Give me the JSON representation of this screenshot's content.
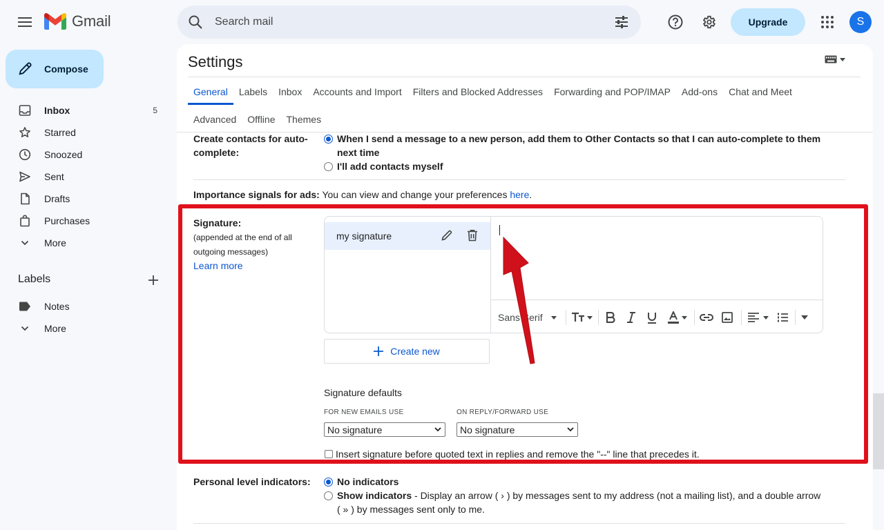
{
  "app": {
    "name": "Gmail"
  },
  "search": {
    "placeholder": "Search mail"
  },
  "header": {
    "upgrade_label": "Upgrade",
    "avatar_letter": "S"
  },
  "sidebar": {
    "compose_label": "Compose",
    "items": [
      {
        "label": "Inbox",
        "count": "5",
        "icon": "inbox-icon",
        "bold": true
      },
      {
        "label": "Starred",
        "count": "",
        "icon": "star-icon"
      },
      {
        "label": "Snoozed",
        "count": "",
        "icon": "clock-icon"
      },
      {
        "label": "Sent",
        "count": "",
        "icon": "send-icon"
      },
      {
        "label": "Drafts",
        "count": "",
        "icon": "draft-icon"
      },
      {
        "label": "Purchases",
        "count": "",
        "icon": "bag-icon"
      },
      {
        "label": "More",
        "count": "",
        "icon": "chevron-down-icon"
      }
    ],
    "labels_heading": "Labels",
    "label_items": [
      {
        "label": "Notes",
        "icon": "label-icon"
      },
      {
        "label": "More",
        "icon": "chevron-down-icon"
      }
    ]
  },
  "settings": {
    "title": "Settings",
    "tabs_row1": [
      "General",
      "Labels",
      "Inbox",
      "Accounts and Import",
      "Filters and Blocked Addresses",
      "Forwarding and POP/IMAP",
      "Add-ons",
      "Chat and Meet"
    ],
    "tabs_row2": [
      "Advanced",
      "Offline",
      "Themes"
    ],
    "active_tab": "General",
    "contacts": {
      "label_line1": "Create contacts for auto-",
      "label_line2": "complete:",
      "option1_line1": "When I send a message to a new person, add them to Other Contacts so that I can auto-complete to them",
      "option1_line2": "next time",
      "option2": "I'll add contacts myself"
    },
    "importance": {
      "label": "Importance signals for ads:",
      "text": "You can view and change your preferences",
      "link": "here",
      "period": "."
    },
    "signature": {
      "label": "Signature:",
      "sub1": "(appended at the end of all",
      "sub2": "outgoing messages)",
      "learn_more": "Learn more",
      "items": [
        {
          "name": "my signature"
        }
      ],
      "toolbar_font": "Sans Serif",
      "create_new": "Create new",
      "defaults_title": "Signature defaults",
      "new_emails_label": "FOR NEW EMAILS USE",
      "new_emails_value": "No signature",
      "reply_label": "ON REPLY/FORWARD USE",
      "reply_value": "No signature",
      "insert_before": "Insert signature before quoted text in replies and remove the \"--\" line that precedes it."
    },
    "indicators": {
      "label": "Personal level indicators:",
      "option1": "No indicators",
      "option2_bold": "Show indicators",
      "option2_text": " - Display an arrow ( › ) by messages sent to my address (not a mailing list), and a double arrow",
      "option2_line2": "( » ) by messages sent only to me."
    }
  },
  "colors": {
    "highlight": "#e0111b",
    "accent": "#0b57d0",
    "compose_bg": "#c2e7ff"
  }
}
